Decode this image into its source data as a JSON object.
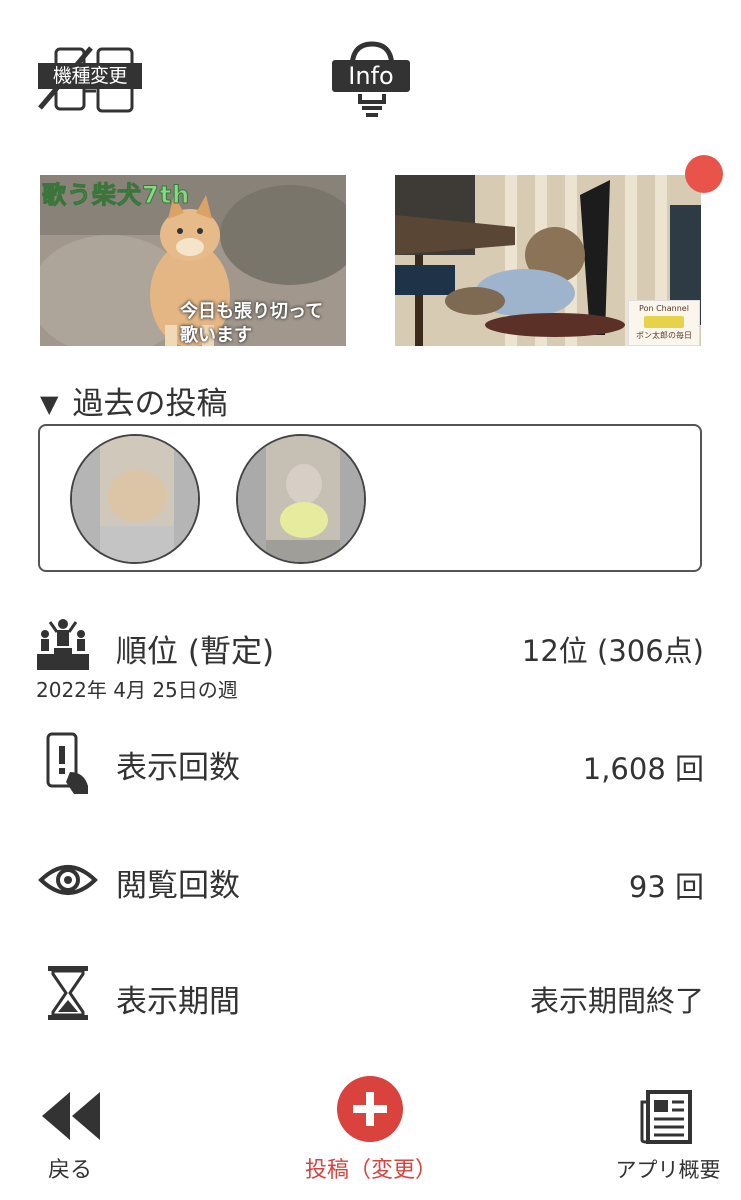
{
  "header": {
    "device_switch_label": "機種変更",
    "info_label": "Info"
  },
  "thumbnails": {
    "first": {
      "overlay_title": "歌う柴犬7th",
      "caption_line1": "今日も張り切って",
      "caption_line2": "歌います"
    },
    "second": {
      "badge_line1": "Pon Channel",
      "badge_line2": "ポン太郎の毎日"
    }
  },
  "past_posts": {
    "title": "過去の投稿",
    "toggle": "▼"
  },
  "stats": {
    "rank": {
      "label": "順位 (暫定)",
      "value": "12位 (306点)",
      "week": "2022年 4月 25日の週"
    },
    "display_count": {
      "label": "表示回数",
      "value": "1,608 回"
    },
    "view_count": {
      "label": "閲覧回数",
      "value": "93 回"
    },
    "display_period": {
      "label": "表示期間",
      "value": "表示期間終了"
    }
  },
  "nav": {
    "back_label": "戻る",
    "post_label": "投稿（変更）",
    "about_label": "アプリ概要"
  },
  "colors": {
    "accent": "#d9423d",
    "notification_dot": "#e8544a",
    "text": "#333333"
  }
}
